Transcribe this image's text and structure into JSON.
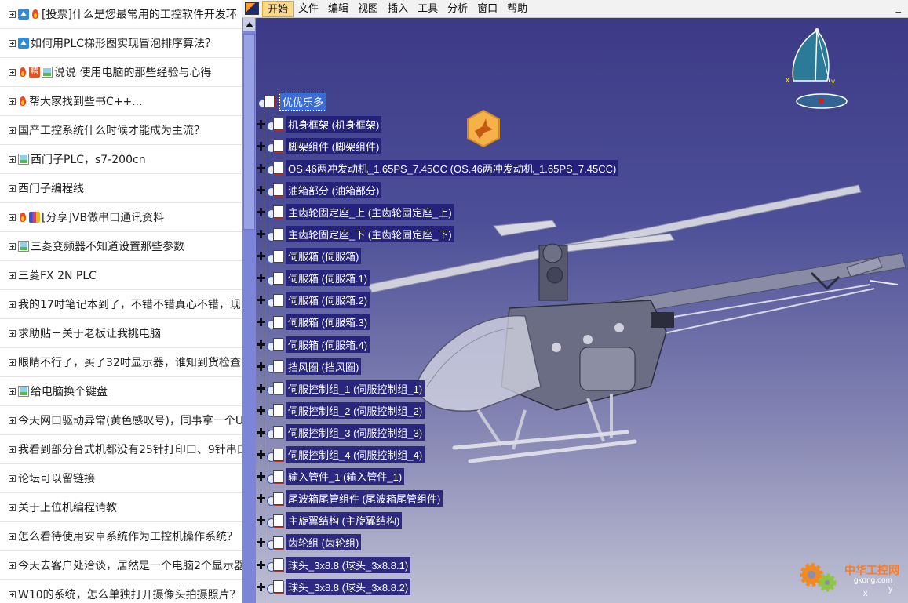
{
  "forum": {
    "rows": [
      {
        "icons": [
          "up-arrow-icon",
          "hot-icon"
        ],
        "text": "[投票]什么是您最常用的工控软件开发环"
      },
      {
        "icons": [
          "up-arrow-icon"
        ],
        "text": "如何用PLC梯形图实现冒泡排序算法？"
      },
      {
        "icons": [
          "hot-icon",
          "jing-icon",
          "image-icon"
        ],
        "text": "说说 使用电脑的那些经验与心得"
      },
      {
        "icons": [
          "hot-icon"
        ],
        "text": "帮大家找到些书C++..."
      },
      {
        "icons": [],
        "text": "国产工控系统什么时候才能成为主流？"
      },
      {
        "icons": [
          "image-icon"
        ],
        "text": "西门子PLC，s7-200cn"
      },
      {
        "icons": [],
        "text": "西门子编程线"
      },
      {
        "icons": [
          "hot-icon",
          "book-icon"
        ],
        "text": "[分享]VB做串口通讯资料"
      },
      {
        "icons": [
          "image-icon"
        ],
        "text": "三菱变频器不知道设置那些参数"
      },
      {
        "icons": [],
        "text": "三菱FX 2N PLC"
      },
      {
        "icons": [],
        "text": "我的17吋笔记本到了，不错不错真心不错，现"
      },
      {
        "icons": [],
        "text": "求助贴－关于老板让我挑电脑"
      },
      {
        "icons": [],
        "text": "眼睛不行了，买了32吋显示器，谁知到货检查"
      },
      {
        "icons": [
          "image-icon"
        ],
        "text": "给电脑换个键盘"
      },
      {
        "icons": [],
        "text": "今天网口驱动异常(黄色感叹号)，同事拿一个U"
      },
      {
        "icons": [],
        "text": "我看到部分台式机都没有25针打印口、9针串口"
      },
      {
        "icons": [],
        "text": "论坛可以留链接"
      },
      {
        "icons": [],
        "text": "关于上位机编程请教"
      },
      {
        "icons": [],
        "text": "怎么看待使用安卓系统作为工控机操作系统？"
      },
      {
        "icons": [],
        "text": "今天去客户处洽谈，居然是一个电脑2个显示器"
      },
      {
        "icons": [],
        "text": "W10的系统，怎么单独打开摄像头拍摄照片？"
      }
    ]
  },
  "catia": {
    "menu": [
      "开始",
      "文件",
      "编辑",
      "视图",
      "插入",
      "工具",
      "分析",
      "窗口",
      "帮助"
    ],
    "minimize": "_",
    "tree": {
      "root": "优优乐多",
      "nodes": [
        "机身框架 (机身框架)",
        "脚架组件 (脚架组件)",
        "OS.46两冲发动机_1.65PS_7.45CC (OS.46两冲发动机_1.65PS_7.45CC)",
        "油箱部分 (油箱部分)",
        "主齿轮固定座_上 (主齿轮固定座_上)",
        "主齿轮固定座_下 (主齿轮固定座_下)",
        "伺服箱 (伺服箱)",
        "伺服箱 (伺服箱.1)",
        "伺服箱 (伺服箱.2)",
        "伺服箱 (伺服箱.3)",
        "伺服箱 (伺服箱.4)",
        "挡风圈 (挡风圈)",
        "伺服控制组_1 (伺服控制组_1)",
        "伺服控制组_2 (伺服控制组_2)",
        "伺服控制组_3 (伺服控制组_3)",
        "伺服控制组_4 (伺服控制组_4)",
        "输入管件_1 (输入管件_1)",
        "尾波箱尾管组件 (尾波箱尾管组件)",
        "主旋翼结构 (主旋翼结构)",
        "齿轮组 (齿轮组)",
        "球头_3x8.8 (球头_3x8.8.1)",
        "球头_3x8.8 (球头_3x8.8.2)"
      ]
    },
    "compass": {
      "x_label": "x",
      "y_label": "y"
    },
    "watermark": {
      "name": "中华工控网",
      "url": "gkong.com",
      "axis_x": "x",
      "axis_y": "y"
    },
    "colors": {
      "background_top": "#3c3a86",
      "tree_highlight": "#3a6bd6",
      "menu_active": "#fbd98a"
    }
  }
}
